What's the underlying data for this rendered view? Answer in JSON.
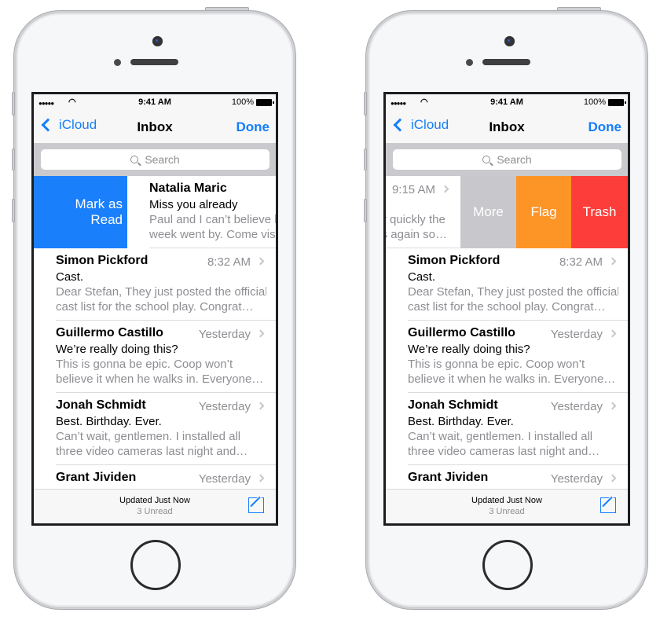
{
  "colors": {
    "accent": "#157efb",
    "mark_read": "#1a7ffb",
    "more": "#c7c7cc",
    "flag": "#fd9426",
    "trash": "#fc3d39"
  },
  "status": {
    "signal": "●●●●●",
    "wifi": "wifi-icon",
    "time": "9:41 AM",
    "battery": "100%"
  },
  "nav": {
    "back": "iCloud",
    "title": "Inbox",
    "done": "Done"
  },
  "search": {
    "placeholder": "Search"
  },
  "messages": [
    {
      "name": "Natalia Maric",
      "time": "9:15 AM",
      "subject": "Miss you already",
      "preview": [
        "Paul and I can’t believe how quickly the",
        "week went by. Come visit us again so…"
      ]
    },
    {
      "name": "Simon Pickford",
      "time": "8:32 AM",
      "subject": "Cast.",
      "preview": [
        "Dear Stefan, They just posted the official",
        "cast list for the school play. Congrat…"
      ]
    },
    {
      "name": "Guillermo Castillo",
      "time": "Yesterday",
      "subject": "We’re really doing this?",
      "preview": [
        "This is gonna be epic. Coop won’t",
        "believe it when he walks in. Everyone…"
      ]
    },
    {
      "name": "Jonah Schmidt",
      "time": "Yesterday",
      "subject": "Best. Birthday. Ever.",
      "preview": [
        "Can’t wait, gentlemen. I installed all",
        "three video cameras last night and…"
      ]
    },
    {
      "name": "Grant Jividen",
      "time": "Yesterday",
      "subject": "",
      "preview": [
        "",
        ""
      ]
    }
  ],
  "actions": {
    "mark_as_read": "Mark as Read",
    "more": "More",
    "flag": "Flag",
    "trash": "Trash"
  },
  "toolbar": {
    "updated": "Updated Just Now",
    "unread": "3 Unread"
  },
  "phones": [
    {
      "state": "swipe-right"
    },
    {
      "state": "swipe-left"
    }
  ]
}
